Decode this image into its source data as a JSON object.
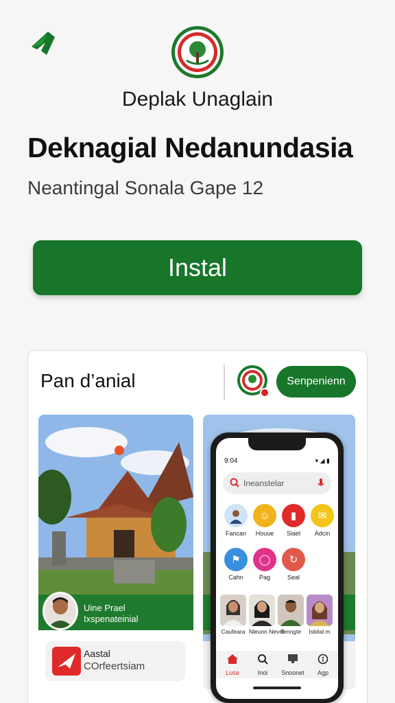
{
  "header": {
    "back_icon": "green-arrow-logo-icon",
    "app_logo": "round-emblem-logo",
    "developer": "Deplak Unaglain",
    "title": "Deknagial Nedanundasia",
    "subtitle": "Neantingal Sonala Gape 12"
  },
  "install": {
    "label": "Instal"
  },
  "preview_card": {
    "title": "Pan d’anial",
    "action_label": "Senpenienn",
    "left_screenshot": {
      "profile_name": "Uine Prael",
      "profile_subtitle": "Ixspenateinial",
      "card_title": "Aastal",
      "card_subtitle": "COrfeertsiam"
    },
    "phone": {
      "time": "9:04",
      "search_placeholder": "Ineanstelar",
      "apps": [
        {
          "label": "Fancan",
          "icon": "person-avatar-icon",
          "color": "#cfe3f5"
        },
        {
          "label": "Houue",
          "icon": "smiley-icon",
          "color": "#f2b21b"
        },
        {
          "label": "Siael",
          "icon": "card-icon",
          "color": "#e02a2a"
        },
        {
          "label": "Adcin",
          "icon": "envelope-icon",
          "color": "#f4c61c"
        },
        {
          "label": "Cahn",
          "icon": "flag-icon",
          "color": "#3a8ee0"
        },
        {
          "label": "Pag",
          "icon": "chat-icon",
          "color": "#e0338a"
        },
        {
          "label": "Seal",
          "icon": "refresh-icon",
          "color": "#e0584a"
        }
      ],
      "contacts": [
        {
          "label": "Caufeara"
        },
        {
          "label": "Nleunn Nevel"
        },
        {
          "label": "Tenngte"
        },
        {
          "label": "Isbilal m"
        }
      ],
      "nav": [
        {
          "label": "Lusa",
          "icon": "home-icon"
        },
        {
          "label": "Inoi",
          "icon": "search-icon"
        },
        {
          "label": "Snoonet",
          "icon": "monitor-icon"
        },
        {
          "label": "Agp",
          "icon": "info-icon"
        }
      ]
    }
  },
  "colors": {
    "accent": "#17762a",
    "background": "#f6f6f6"
  }
}
